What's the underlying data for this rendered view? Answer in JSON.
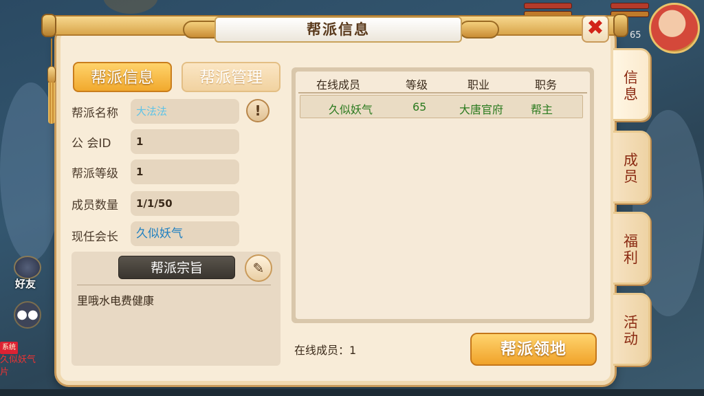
{
  "window": {
    "title": "帮派信息",
    "close_icon": "close-x-icon"
  },
  "hud": {
    "level": "65",
    "friend_label": "好友",
    "chat_icon": "chat-bubble-icon",
    "chat_tag": "系统",
    "chat_text": "久似妖气",
    "chat_text2": "片"
  },
  "side_tabs": [
    {
      "label": "信息",
      "active": true
    },
    {
      "label": "成员",
      "active": false
    },
    {
      "label": "福利",
      "active": false
    },
    {
      "label": "活动",
      "active": false
    }
  ],
  "top_tabs": {
    "info": "帮派信息",
    "manage": "帮派管理"
  },
  "info": {
    "name_label": "帮派名称",
    "name_value": "大法法",
    "guild_id_label": "公 会ID",
    "guild_id_value": "1",
    "level_label": "帮派等级",
    "level_value": "1",
    "members_label": "成员数量",
    "members_value": "1/1/50",
    "leader_label": "现任会长",
    "leader_value": "久似妖气",
    "warn_icon": "exclamation-icon"
  },
  "motto": {
    "header": "帮派宗旨",
    "edit_icon": "pencil-edit-icon",
    "text": "里哦水电费健康"
  },
  "member_table": {
    "columns": [
      "在线成员",
      "等级",
      "职业",
      "职务"
    ],
    "rows": [
      {
        "name": "久似妖气",
        "level": "65",
        "profession": "大唐官府",
        "position": "帮主"
      }
    ]
  },
  "footer": {
    "online_label": "在线成员：",
    "online_value": "1",
    "territory_button": "帮派领地"
  },
  "colors": {
    "accent": "#f1a92e",
    "panel": "#f8ecd8",
    "member_text": "#2a7a1e",
    "close_red": "#d22318"
  }
}
